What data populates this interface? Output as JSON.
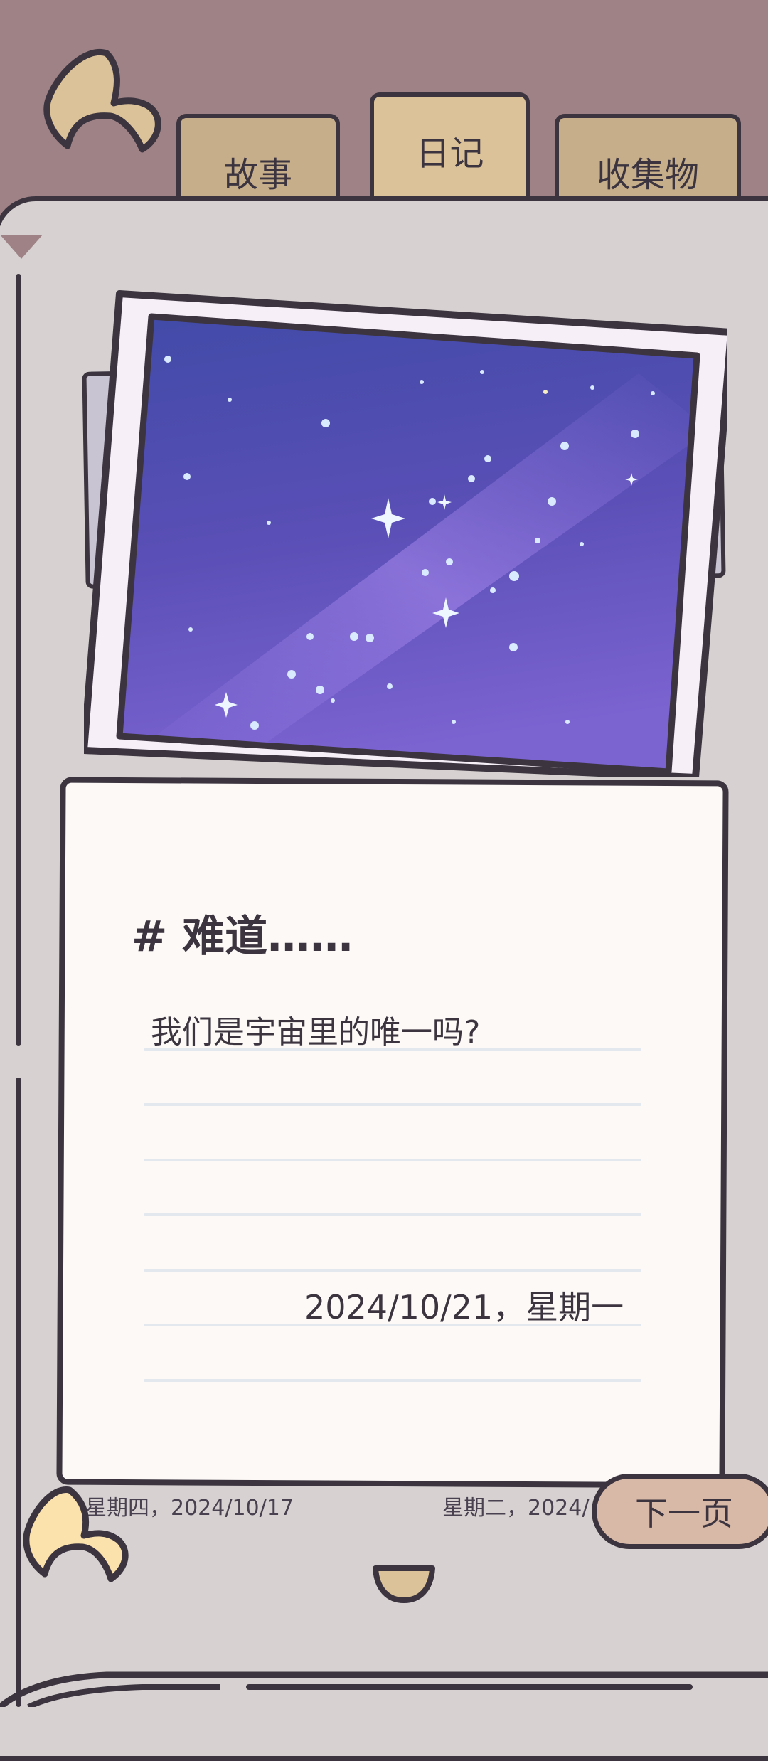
{
  "tabs": [
    {
      "label": "故事"
    },
    {
      "label": "日记"
    },
    {
      "label": "收集物"
    }
  ],
  "diary": {
    "title": "# 难道……",
    "body": "我们是宇宙里的唯一吗?",
    "date": "2024/10/21，星期一"
  },
  "footer": {
    "prev_entry": "星期四，2024/10/17",
    "next_entry": "星期二，2024/",
    "next_button": "下一页"
  },
  "colors": {
    "outline": "#3c3540",
    "background": "#9e8286",
    "page": "#d7d2d1",
    "card": "#fcf9f6",
    "tab": "#c7ae8b",
    "accent_button": "#d8b8a6"
  },
  "icons": [
    "back-arrow-icon",
    "prev-arrow-icon",
    "page-handle-icon"
  ]
}
